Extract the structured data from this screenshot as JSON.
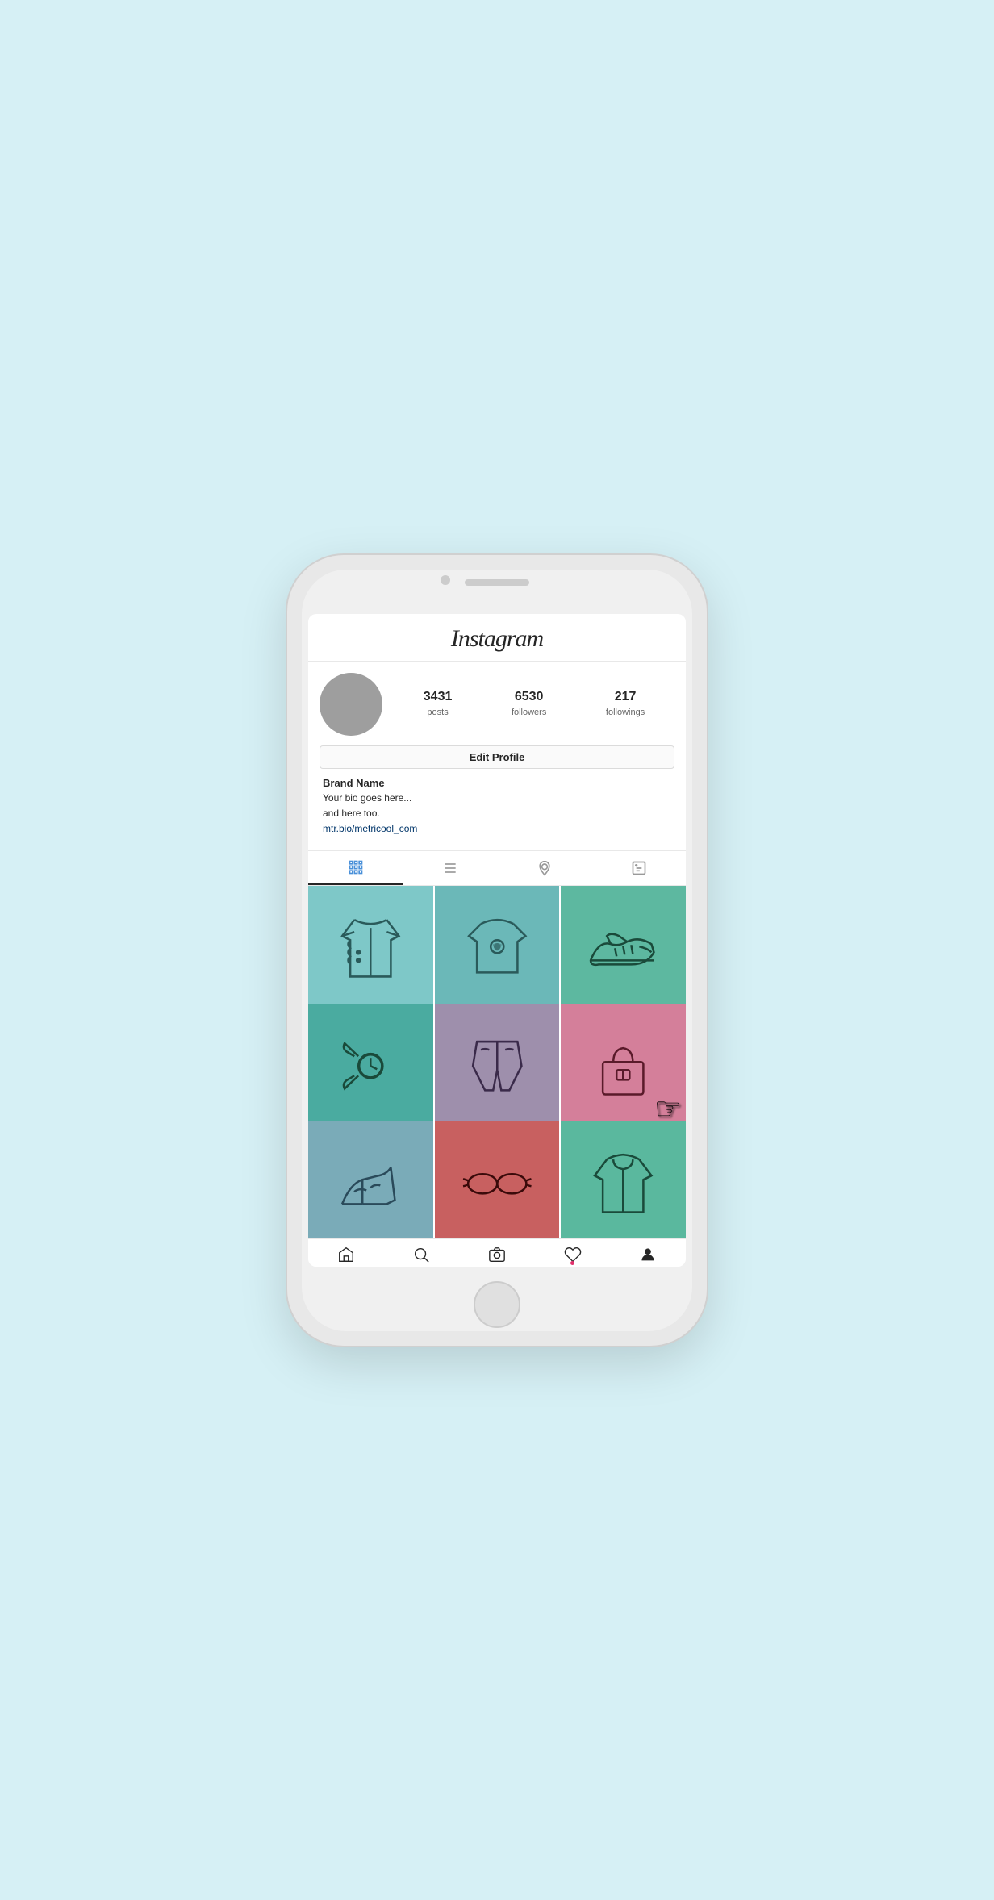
{
  "app": {
    "name": "Instagram"
  },
  "profile": {
    "avatar_placeholder": "avatar",
    "stats": [
      {
        "value": "3431",
        "label": "posts"
      },
      {
        "value": "6530",
        "label": "followers"
      },
      {
        "value": "217",
        "label": "followings"
      }
    ],
    "edit_button_label": "Edit Profile",
    "brand_name": "Brand Name",
    "bio_line1": "Your bio goes here...",
    "bio_line2": "and here too.",
    "bio_link": "mtr.bio/metricool_com"
  },
  "tabs": [
    {
      "id": "grid",
      "label": "Grid View",
      "active": true
    },
    {
      "id": "list",
      "label": "List View",
      "active": false
    },
    {
      "id": "location",
      "label": "Location",
      "active": false
    },
    {
      "id": "tagged",
      "label": "Tagged",
      "active": false
    }
  ],
  "grid": [
    {
      "id": 1,
      "color": "teal-light",
      "item": "jacket"
    },
    {
      "id": 2,
      "color": "teal-mid",
      "item": "tshirt"
    },
    {
      "id": 3,
      "color": "teal-green",
      "item": "sneaker"
    },
    {
      "id": 4,
      "color": "teal-dark",
      "item": "watch"
    },
    {
      "id": 5,
      "color": "mauve",
      "item": "pants"
    },
    {
      "id": 6,
      "color": "pink",
      "item": "bag"
    },
    {
      "id": 7,
      "color": "blue-gray",
      "item": "heels"
    },
    {
      "id": 8,
      "color": "salmon",
      "item": "glasses"
    },
    {
      "id": 9,
      "color": "mint",
      "item": "hoodie"
    }
  ],
  "bottom_nav": [
    {
      "id": "home",
      "label": "Home"
    },
    {
      "id": "search",
      "label": "Search"
    },
    {
      "id": "camera",
      "label": "Camera"
    },
    {
      "id": "activity",
      "label": "Activity",
      "has_dot": true
    },
    {
      "id": "profile",
      "label": "Profile",
      "active": true
    }
  ]
}
